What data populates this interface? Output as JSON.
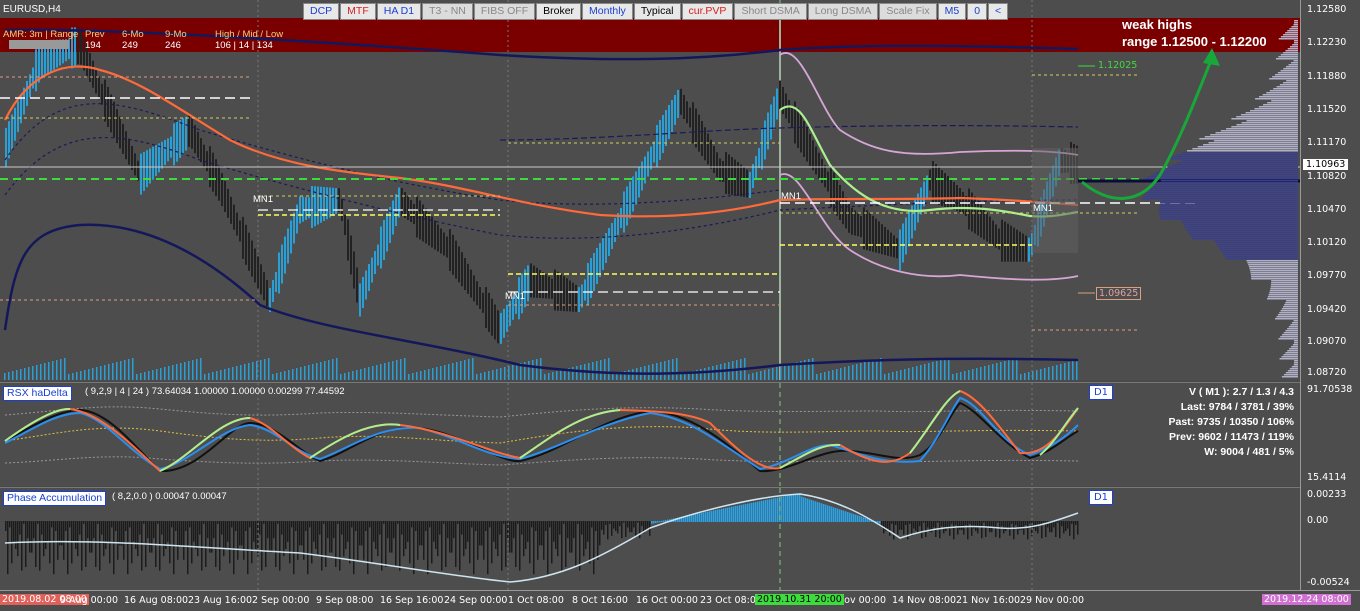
{
  "symbol": "EURUSD,H4",
  "toolbar": [
    {
      "label": "DCP",
      "style": "blue"
    },
    {
      "label": "MTF",
      "style": "red"
    },
    {
      "label": "HA D1",
      "style": "blue"
    },
    {
      "label": "T3 - NN",
      "style": "grey"
    },
    {
      "label": "FIBS OFF",
      "style": "grey"
    },
    {
      "label": "Broker",
      "style": "black"
    },
    {
      "label": "Monthly",
      "style": "blue"
    },
    {
      "label": "Typical",
      "style": "black"
    },
    {
      "label": "cur.PVP",
      "style": "red"
    },
    {
      "label": "Short DSMA",
      "style": "grey"
    },
    {
      "label": "Long DSMA",
      "style": "grey"
    },
    {
      "label": "Scale Fix",
      "style": "grey"
    },
    {
      "label": "M5",
      "style": "blue"
    },
    {
      "label": "0",
      "style": "blue"
    },
    {
      "label": "<",
      "style": "blue"
    }
  ],
  "info": {
    "amr_label": "AMR: 3m | Range",
    "prev_label": "Prev",
    "mo6_label": "6-Mo",
    "mo9_label": "9-Mo",
    "hml_label": "High / Mid / Low",
    "prev_val": "194",
    "mo6_val": "249",
    "mo9_val": "246",
    "hml_val": "106  |  14  |  134"
  },
  "note": {
    "line1": "weak highs",
    "line2": "range 1.12500 - 1.12200"
  },
  "price_axis": [
    "1.12580",
    "1.12230",
    "1.11880",
    "1.11520",
    "1.11170",
    "1.10820",
    "1.10470",
    "1.10120",
    "1.09770",
    "1.09420",
    "1.09070",
    "1.08720"
  ],
  "current_price": "1.10963",
  "level_labels": {
    "upper": "1.12025",
    "lower": "1.09625"
  },
  "mn1_label": "MN1",
  "rsx": {
    "title": "RSX haDelta",
    "params": "( 9,2,9 | 4 | 24 ) 73.64034 1.00000 1.00000 0.00299 77.44592",
    "badge": "D1",
    "axis_top": "91.70538",
    "axis_bottom": "15.4114",
    "stats": [
      "V ( M1 ): 2.7 / 1.3 / 4.3",
      "Last: 9784 / 3781 / 39%",
      "Past: 9735 / 10350 / 106%",
      "Prev: 9602 / 11473 / 119%",
      "W: 9004 / 481 / 5%"
    ]
  },
  "phase": {
    "title": "Phase Accumulation",
    "params": "( 8,2,0.0 ) 0.00047 0.00047",
    "badge": "D1",
    "axis_top": "0.00233",
    "axis_mid": "0.00",
    "axis_bottom": "-0.00524"
  },
  "time_axis": {
    "start": "2019.08.02 08:00",
    "labels": [
      "9 Aug 00:00",
      "16 Aug 08:00",
      "23 Aug 16:00",
      "2 Sep 00:00",
      "9 Sep 08:00",
      "16 Sep 16:00",
      "24 Sep 00:00",
      "1 Oct 08:00",
      "8 Oct 16:00",
      "16 Oct 00:00",
      "23 Oct 08:00",
      "7 Nov 00:00",
      "14 Nov 08:00",
      "21 Nov 16:00",
      "29 Nov 00:00"
    ],
    "cursor": "2019.10.31 20:00",
    "end": "2019.12.24 08:00"
  },
  "colors": {
    "accent_red": "#7a0000",
    "price_up": "#2a9fd6",
    "price_down": "#222222"
  }
}
